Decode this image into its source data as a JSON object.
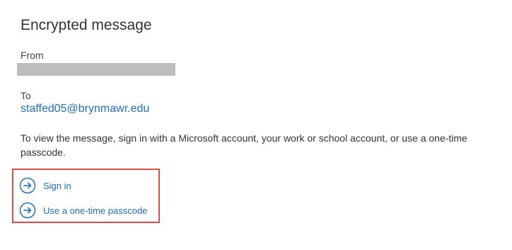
{
  "page": {
    "title": "Encrypted message"
  },
  "sender": {
    "label": "From"
  },
  "recipient": {
    "label": "To",
    "email": "staffed05@brynmawr.edu"
  },
  "instructions": "To view the message, sign in with a Microsoft account, your work or school account, or use a one-time passcode.",
  "actions": [
    {
      "label": "Sign in",
      "icon": "arrow-right-circle-icon"
    },
    {
      "label": "Use a one-time passcode",
      "icon": "arrow-right-circle-icon"
    }
  ],
  "colors": {
    "link": "#1f6fba",
    "highlight_border": "#d9504a",
    "redaction": "#bdbdbd"
  }
}
